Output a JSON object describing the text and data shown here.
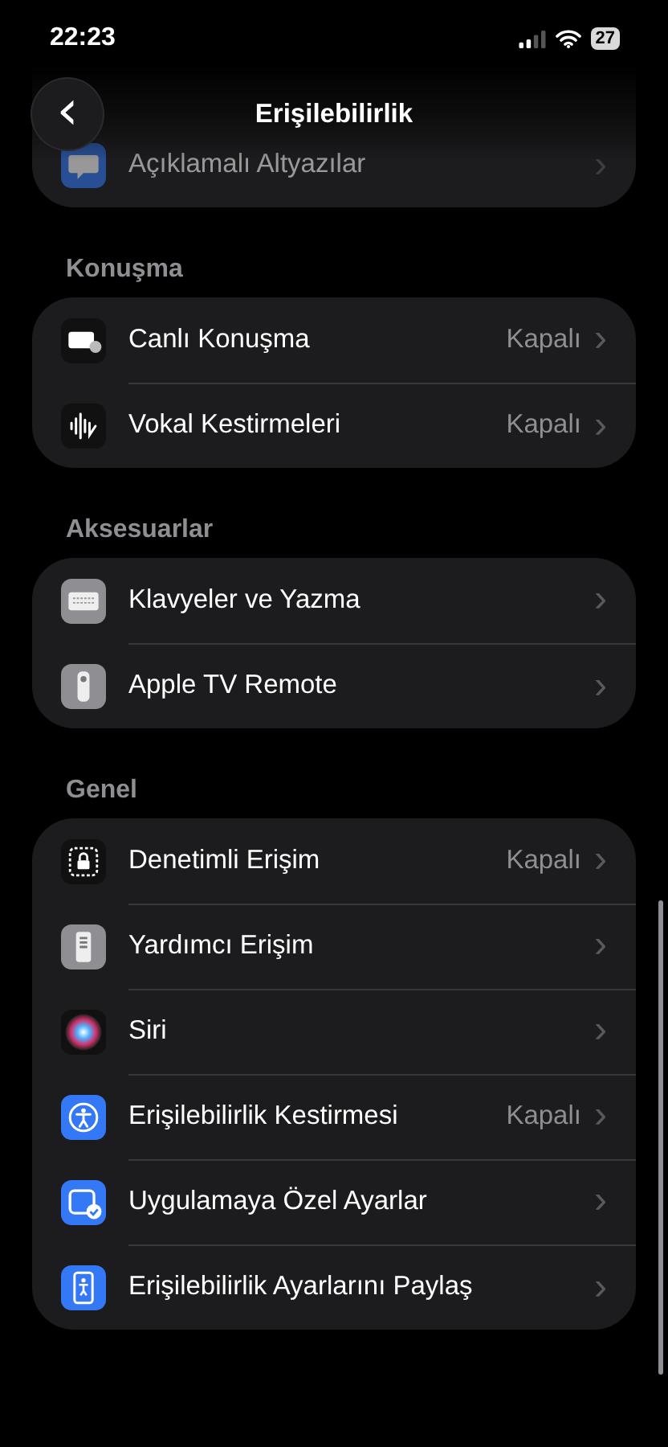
{
  "status_bar": {
    "time": "22:23",
    "battery": "27"
  },
  "header": {
    "title": "Erişilebilirlik",
    "back_icon": "‹"
  },
  "top_rows": [
    {
      "kind": "captions",
      "label": "Açıklamalı Altyazılar",
      "chevron": "›"
    }
  ],
  "sections": [
    {
      "title": "Konuşma",
      "rows": [
        {
          "kind": "livespeech",
          "label": "Canlı Konuşma",
          "value": "Kapalı",
          "chevron": "›"
        },
        {
          "kind": "vocal",
          "label": "Vokal Kestirmeleri",
          "value": "Kapalı",
          "chevron": "›"
        }
      ]
    },
    {
      "title": "Aksesuarlar",
      "rows": [
        {
          "kind": "keyboard",
          "label": "Klavyeler ve Yazma",
          "chevron": "›"
        },
        {
          "kind": "remote",
          "label": "Apple TV Remote",
          "chevron": "›"
        }
      ]
    },
    {
      "title": "Genel",
      "rows": [
        {
          "kind": "guided",
          "label": "Denetimli Erişim",
          "value": "Kapalı",
          "chevron": "›"
        },
        {
          "kind": "assistive",
          "label": "Yardımcı Erişim",
          "chevron": "›"
        },
        {
          "kind": "siri",
          "label": "Siri",
          "chevron": "›"
        },
        {
          "kind": "shortcut",
          "label": "Erişilebilirlik Kestirmesi",
          "value": "Kapalı",
          "chevron": "›"
        },
        {
          "kind": "perapp",
          "label": "Uygulamaya Özel Ayarlar",
          "chevron": "›"
        },
        {
          "kind": "share",
          "label": "Erişilebilirlik Ayarlarını Paylaş",
          "chevron": "›"
        }
      ]
    }
  ]
}
